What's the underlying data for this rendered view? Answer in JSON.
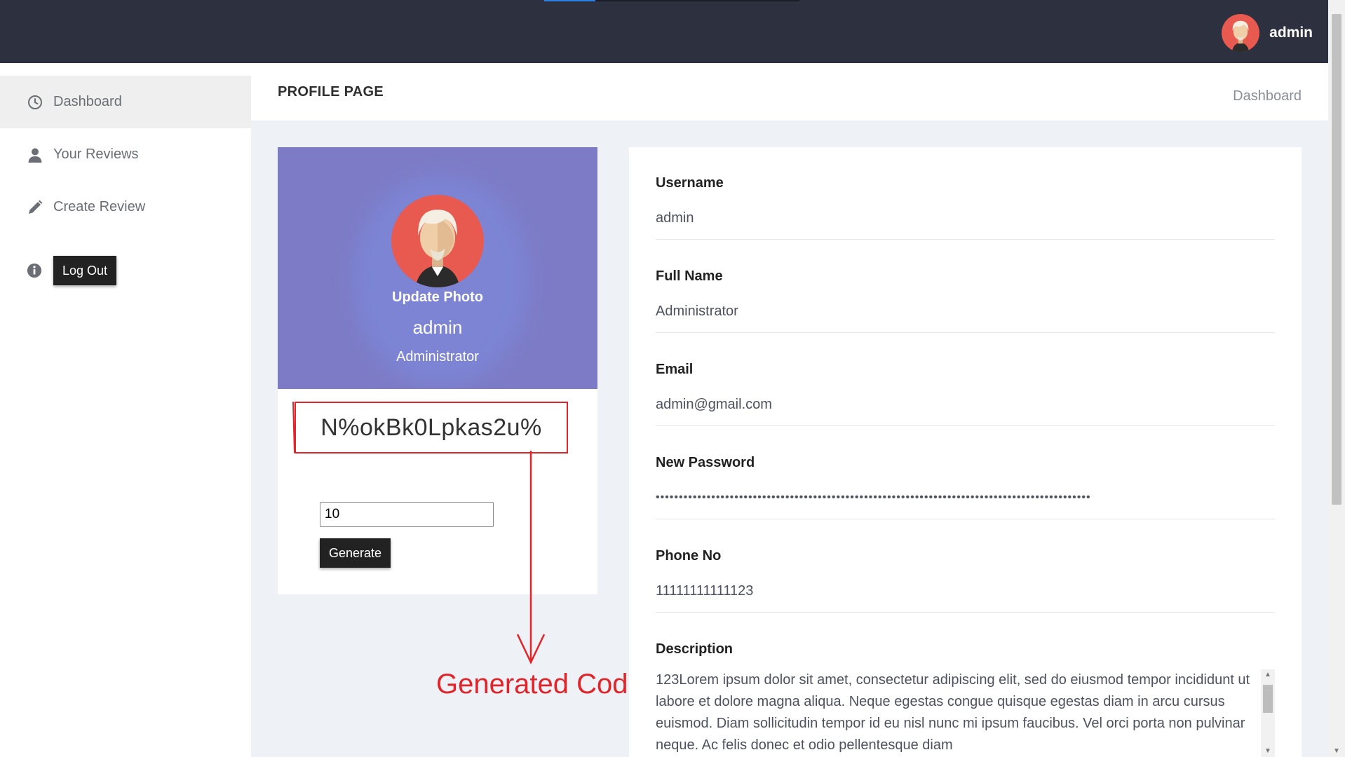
{
  "topbar": {
    "username": "admin",
    "progress_fraction": 0.2
  },
  "sidebar": {
    "items": [
      {
        "label": "Dashboard",
        "icon": "clock-icon"
      },
      {
        "label": "Your Reviews",
        "icon": "user-icon"
      },
      {
        "label": "Create Review",
        "icon": "pencil-icon"
      }
    ],
    "logout": {
      "label": "Log Out",
      "icon": "info-icon"
    }
  },
  "header": {
    "title": "PROFILE PAGE",
    "breadcrumb": "Dashboard"
  },
  "profile": {
    "update_photo": "Update Photo",
    "name": "admin",
    "role": "Administrator",
    "generated_code": "N%okBk0Lpkas2u%",
    "length_value": "10",
    "generate_label": "Generate"
  },
  "annotation": {
    "label": "Generated Code",
    "color": "#e0242a"
  },
  "details": {
    "fields": [
      {
        "label": "Username",
        "value": "admin"
      },
      {
        "label": "Full Name",
        "value": "Administrator"
      },
      {
        "label": "Email",
        "value": "admin@gmail.com"
      },
      {
        "label": "New Password",
        "value": "••••••••••••••••••••••••••••••••••••••••••••••••••••••••••••••••••••••••••••••••••••••••••••••"
      },
      {
        "label": "Phone No",
        "value": "11111111111123"
      }
    ],
    "description_label": "Description",
    "description": "123Lorem ipsum dolor sit amet, consectetur adipiscing elit, sed do eiusmod tempor incididunt ut labore et dolore magna aliqua. Neque egestas congue quisque egestas diam in arcu cursus euismod. Diam sollicitudin tempor id eu nisl nunc mi ipsum faucibus. Vel orci porta non pulvinar neque. Ac felis donec et odio pellentesque diam"
  },
  "colors": {
    "topbar": "#2d303e",
    "hero": "#7d7bc6",
    "annotation": "#e0242a",
    "avatar_bg": "#e85a4f"
  }
}
